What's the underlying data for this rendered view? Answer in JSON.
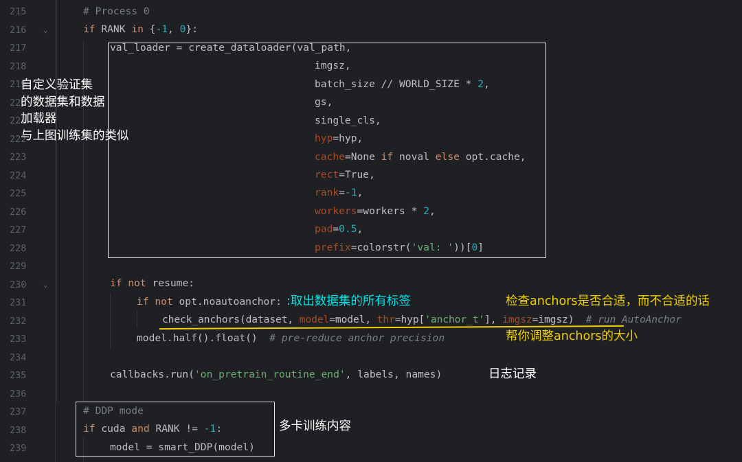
{
  "lines": [
    {
      "n": "215",
      "fold": ""
    },
    {
      "n": "216",
      "fold": "v"
    },
    {
      "n": "217",
      "fold": ""
    },
    {
      "n": "218",
      "fold": ""
    },
    {
      "n": "219",
      "fold": ""
    },
    {
      "n": "220",
      "fold": ""
    },
    {
      "n": "221",
      "fold": ""
    },
    {
      "n": "222",
      "fold": ""
    },
    {
      "n": "223",
      "fold": ""
    },
    {
      "n": "224",
      "fold": ""
    },
    {
      "n": "225",
      "fold": ""
    },
    {
      "n": "226",
      "fold": ""
    },
    {
      "n": "227",
      "fold": ""
    },
    {
      "n": "228",
      "fold": ""
    },
    {
      "n": "229",
      "fold": ""
    },
    {
      "n": "230",
      "fold": "v"
    },
    {
      "n": "231",
      "fold": ""
    },
    {
      "n": "232",
      "fold": ""
    },
    {
      "n": "233",
      "fold": ""
    },
    {
      "n": "234",
      "fold": ""
    },
    {
      "n": "235",
      "fold": ""
    },
    {
      "n": "236",
      "fold": ""
    },
    {
      "n": "237",
      "fold": ""
    },
    {
      "n": "238",
      "fold": ""
    },
    {
      "n": "239",
      "fold": ""
    }
  ],
  "code": {
    "l215_comment": "# Process 0",
    "l216_if": "if",
    "l216_rank": " RANK ",
    "l216_in": "in",
    "l216_open": " {",
    "l216_m1": "-1",
    "l216_comma": ", ",
    "l216_zero": "0",
    "l216_close": "}:",
    "l217": "val_loader = create_dataloader(val_path,",
    "l218": "imgsz,",
    "l219_a": "batch_size // WORLD_SIZE * ",
    "l219_two": "2",
    "l219_b": ",",
    "l220": "gs,",
    "l221": "single_cls,",
    "l222_p": "hyp",
    "l222_v": "=hyp,",
    "l223_p": "cache",
    "l223_a": "=None ",
    "l223_if": "if",
    "l223_b": " noval ",
    "l223_else": "else",
    "l223_c": " opt.cache,",
    "l224_p": "rect",
    "l224_v": "=True,",
    "l225_p": "rank",
    "l225_a": "=",
    "l225_n": "-1",
    "l225_b": ",",
    "l226_p": "workers",
    "l226_a": "=workers * ",
    "l226_n": "2",
    "l226_b": ",",
    "l227_p": "pad",
    "l227_a": "=",
    "l227_n": "0.5",
    "l227_b": ",",
    "l228_p": "prefix",
    "l228_a": "=colorstr(",
    "l228_s": "'val: '",
    "l228_b": "))[",
    "l228_n": "0",
    "l228_c": "]",
    "l230_if": "if",
    "l230_not": " not",
    "l230_v": " resume:",
    "l231_if": "if",
    "l231_not": " not",
    "l231_v": " opt.noautoanchor:",
    "l232_a": "check_anchors(dataset, ",
    "l232_p1": "model",
    "l232_b": "=model, ",
    "l232_p2": "thr",
    "l232_c": "=hyp[",
    "l232_s": "'anchor_t'",
    "l232_d": "], ",
    "l232_p3": "imgsz",
    "l232_e": "=imgsz)",
    "l232_cmt": "  # run AutoAnchor",
    "l233_a": "model.half().float()",
    "l233_cmt": "  # pre-reduce anchor precision",
    "l235_a": "callbacks.run(",
    "l235_s": "'on_pretrain_routine_end'",
    "l235_b": ", labels, names)",
    "l237_comment": "# DDP mode",
    "l238_if": "if",
    "l238_a": " cuda ",
    "l238_and": "and",
    "l238_b": " RANK != ",
    "l238_n": "-1",
    "l238_c": ":",
    "l239": "model = smart_DDP(model)"
  },
  "annotations": {
    "dataloader_note": "自定义验证集\n的数据集和数据\n加载器\n与上图训练集的类似",
    "labels_note": ":取出数据集的所有标签",
    "anchors_note_1": "检查anchors是否合适，而不合适的话",
    "anchors_note_2": "帮你调整anchors的大小",
    "log_note": "日志记录",
    "ddp_note": "多卡训练内容"
  },
  "colors": {
    "background": "#1f2024",
    "keyword": "#cf8e6d",
    "number": "#2aacb8",
    "string": "#6aab73",
    "param": "#aa4926",
    "comment": "#7a7e85",
    "note_white": "#ffffff",
    "note_cyan": "#00e5e5",
    "note_yellow": "#f0d000"
  }
}
